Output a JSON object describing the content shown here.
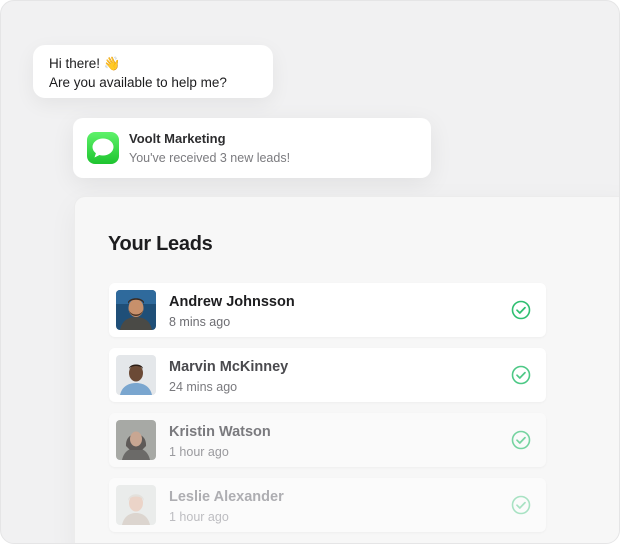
{
  "chat": {
    "line1": "Hi there! 👋",
    "line2": "Are you available to help me?"
  },
  "notification": {
    "app_icon": "messages-icon",
    "title": "Voolt Marketing",
    "subtitle": "You've received 3 new leads!"
  },
  "panel": {
    "title": "Your Leads",
    "leads": [
      {
        "name": "Andrew Johnsson",
        "time": "8 mins ago",
        "status_icon": "check-circle-icon"
      },
      {
        "name": "Marvin McKinney",
        "time": "24 mins ago",
        "status_icon": "check-circle-icon"
      },
      {
        "name": "Kristin Watson",
        "time": "1 hour ago",
        "status_icon": "check-circle-icon"
      },
      {
        "name": "Leslie Alexander",
        "time": "1 hour ago",
        "status_icon": "check-circle-icon"
      }
    ]
  },
  "colors": {
    "accent_green": "#2fbf71",
    "message_icon_green": "#2fd13e"
  }
}
